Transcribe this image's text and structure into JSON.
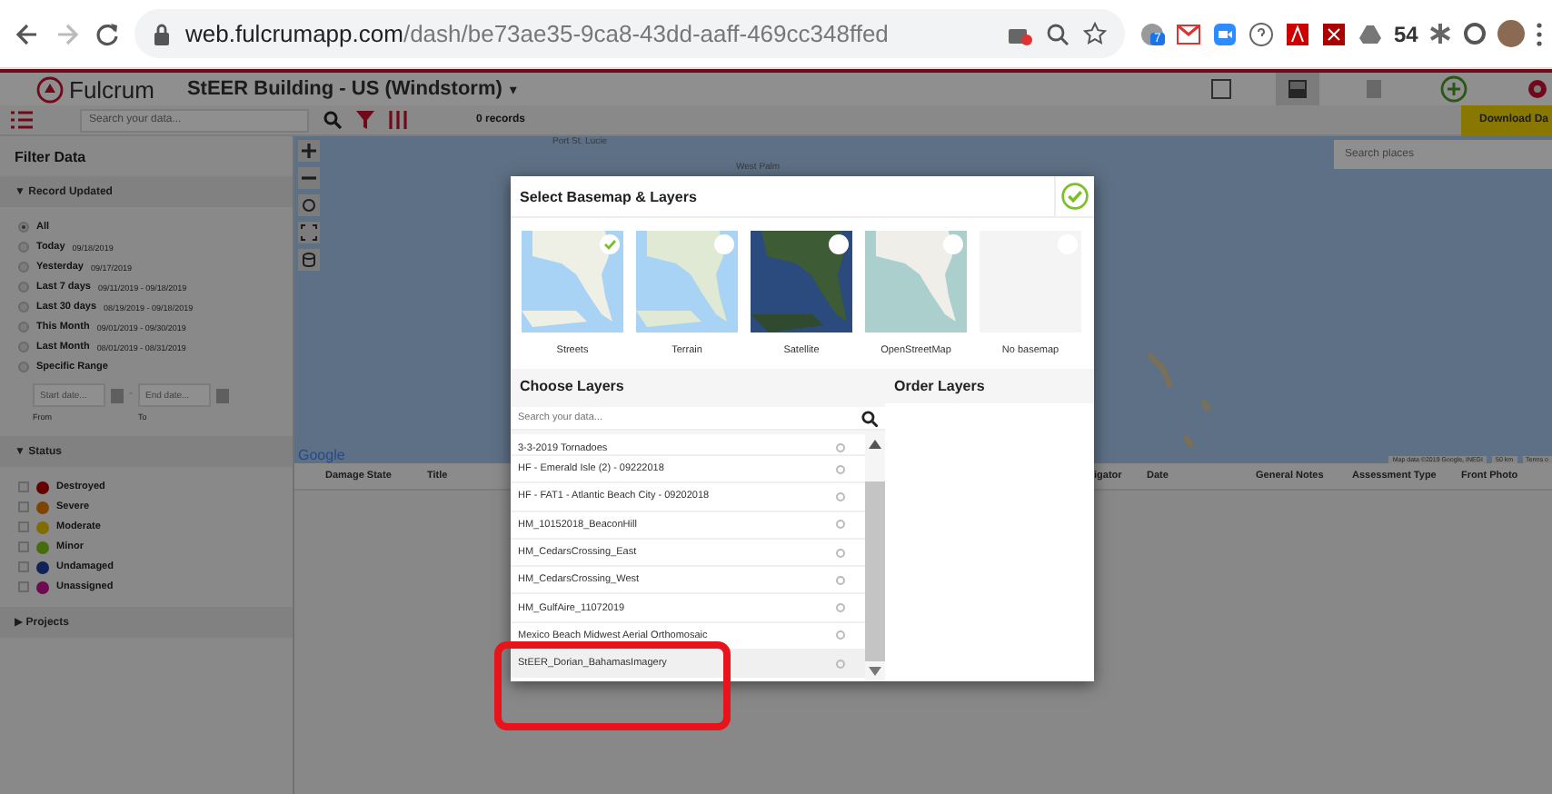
{
  "browser": {
    "url_host": "web.fulcrumapp.com",
    "url_path": "/dash/be73ae35-9ca8-43dd-aaff-469cc348ffed",
    "extension_count": "54",
    "notification_badge": "7"
  },
  "app": {
    "logo": "Fulcrum",
    "project_title": "StEER Building - US (Windstorm)",
    "caret": "▾"
  },
  "toolbar": {
    "search": {
      "placeholder": "Search your data..."
    },
    "records": "0 records",
    "download_button": "Download Da"
  },
  "sidebar": {
    "title": "Filter Data",
    "sections": [
      {
        "kind": "radios",
        "title": "Record Updated",
        "toggle": "▼",
        "options": [
          {
            "label": "All",
            "selected": true
          },
          {
            "label": "Today",
            "hint": "09/18/2019",
            "selected": false
          },
          {
            "label": "Yesterday",
            "hint": "09/17/2019",
            "selected": false
          },
          {
            "label": "Last 7 days",
            "hint": "09/11/2019 - 09/18/2019",
            "selected": false
          },
          {
            "label": "Last 30 days",
            "hint": "08/19/2019 - 09/18/2019",
            "selected": false
          },
          {
            "label": "This Month",
            "hint": "09/01/2019 - 09/30/2019",
            "selected": false
          },
          {
            "label": "Last Month",
            "hint": "08/01/2019 - 08/31/2019",
            "selected": false
          },
          {
            "label": "Specific Range",
            "selected": false
          }
        ],
        "range": {
          "start": {
            "placeholder": "Start date..."
          },
          "end": {
            "placeholder": "End date..."
          },
          "start_caption": "From",
          "end_caption": "To",
          "separator": "-"
        }
      },
      {
        "kind": "checks",
        "title": "Status",
        "toggle": "▼",
        "options": [
          {
            "label": "Destroyed",
            "color": "#640000",
            "checked": false
          },
          {
            "label": "Severe",
            "color": "#7d4500",
            "checked": false
          },
          {
            "label": "Moderate",
            "color": "#826b00",
            "checked": false
          },
          {
            "label": "Minor",
            "color": "#476c0f",
            "checked": false
          },
          {
            "label": "Undamaged",
            "color": "#0f2358",
            "checked": false
          },
          {
            "label": "Unassigned",
            "color": "#6e0a50",
            "checked": false
          }
        ]
      },
      {
        "kind": "collapsed",
        "title": "Projects",
        "toggle": "▶"
      }
    ]
  },
  "map": {
    "labels": [
      "Port St. Lucie",
      "West Palm"
    ],
    "search": {
      "placeholder": "Search places"
    },
    "provider": "Google",
    "attribution": "Map data ©2019 Google, INEGI",
    "scale": "50 km",
    "terms": "Terms o"
  },
  "table": {
    "columns": [
      "Damage State",
      "Title",
      "igator",
      "Date",
      "General Notes",
      "Assessment Type",
      "Front Photo"
    ]
  },
  "modal": {
    "title": "Select Basemap & Layers",
    "basemaps": [
      {
        "kind": "streets",
        "label": "Streets",
        "selected": true
      },
      {
        "kind": "terrain",
        "label": "Terrain",
        "selected": false
      },
      {
        "kind": "satellite",
        "label": "Satellite",
        "selected": false
      },
      {
        "kind": "osm",
        "label": "OpenStreetMap",
        "selected": false
      },
      {
        "kind": "none",
        "label": "No basemap",
        "selected": false
      }
    ],
    "choose_title": "Choose Layers",
    "order_title": "Order Layers",
    "layer_search": {
      "placeholder": "Search your data..."
    },
    "layers": [
      {
        "label": "3-3-2019 Tornadoes",
        "checked": false,
        "hovered": false
      },
      {
        "label": "HF - Emerald Isle (2) - 09222018",
        "checked": false,
        "hovered": false
      },
      {
        "label": "HF - FAT1 - Atlantic Beach City - 09202018",
        "checked": false,
        "hovered": false
      },
      {
        "label": "HM_10152018_BeaconHill",
        "checked": false,
        "hovered": false
      },
      {
        "label": "HM_CedarsCrossing_East",
        "checked": false,
        "hovered": false
      },
      {
        "label": "HM_CedarsCrossing_West",
        "checked": false,
        "hovered": false
      },
      {
        "label": "HM_GulfAire_11072019",
        "checked": false,
        "hovered": false
      },
      {
        "label": "Mexico Beach Midwest Aerial Orthomosaic",
        "checked": false,
        "hovered": false
      },
      {
        "label": "StEER_Dorian_BahamasImagery",
        "checked": false,
        "hovered": true
      }
    ]
  },
  "annotation": {
    "kind": "highlight"
  }
}
